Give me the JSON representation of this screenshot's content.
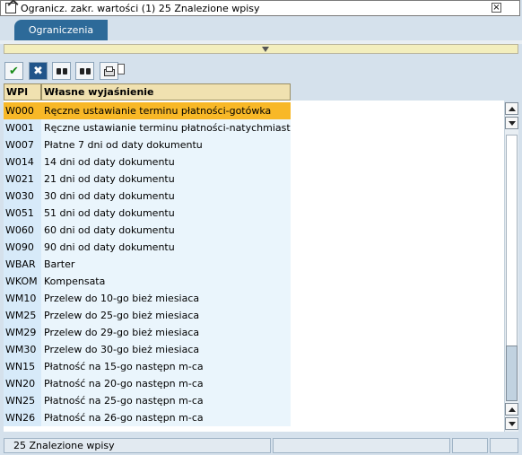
{
  "window": {
    "title": "Ogranicz. zakr. wartości (1)   25 Znalezione wpisy",
    "close_label": "×"
  },
  "tabs": [
    {
      "label": "Ograniczenia"
    }
  ],
  "toolbar": {
    "check_icon": "✔",
    "cancel_icon": "✖"
  },
  "table": {
    "columns": [
      "WPl",
      "Własne wyjaśnienie"
    ],
    "selected_index": 0,
    "rows": [
      {
        "key": "W000",
        "desc": "Ręczne ustawianie terminu płatności-gotówka"
      },
      {
        "key": "W001",
        "desc": "Ręczne ustawianie terminu płatności-natychmiast"
      },
      {
        "key": "W007",
        "desc": "Płatne 7 dni od daty dokumentu"
      },
      {
        "key": "W014",
        "desc": "14 dni od daty dokumentu"
      },
      {
        "key": "W021",
        "desc": "21 dni od daty dokumentu"
      },
      {
        "key": "W030",
        "desc": "30 dni od daty  dokumentu"
      },
      {
        "key": "W051",
        "desc": "51 dni od daty  dokumentu"
      },
      {
        "key": "W060",
        "desc": "60 dni od daty  dokumentu"
      },
      {
        "key": "W090",
        "desc": "90 dni od daty dokumentu"
      },
      {
        "key": "WBAR",
        "desc": "Barter"
      },
      {
        "key": "WKOM",
        "desc": "Kompensata"
      },
      {
        "key": "WM10",
        "desc": "Przelew do 10-go bież miesiaca"
      },
      {
        "key": "WM25",
        "desc": "Przelew do 25-go bież miesiaca"
      },
      {
        "key": "WM29",
        "desc": "Przelew do 29-go bież miesiaca"
      },
      {
        "key": "WM30",
        "desc": "Przelew do 30-go bież miesiaca"
      },
      {
        "key": "WN15",
        "desc": "Płatność na 15-go następn m-ca"
      },
      {
        "key": "WN20",
        "desc": "Płatność na 20-go następn m-ca"
      },
      {
        "key": "WN25",
        "desc": "Płatność na 25-go następn m-ca"
      },
      {
        "key": "WN26",
        "desc": "Płatność na 26-go następn m-ca"
      }
    ]
  },
  "status": {
    "text": "25 Znalezione wpisy"
  },
  "colors": {
    "selected_row": "#f8b827",
    "key_column": "#d7eaf9",
    "desc_column": "#eaf5fc",
    "header": "#f0e1b0",
    "tab_active": "#2d6a99"
  }
}
